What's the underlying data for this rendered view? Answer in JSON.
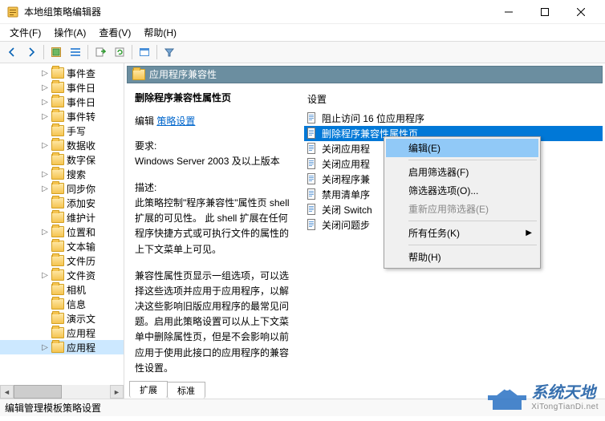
{
  "window": {
    "title": "本地组策略编辑器"
  },
  "menu": {
    "file": "文件(F)",
    "action": "操作(A)",
    "view": "查看(V)",
    "help": "帮助(H)"
  },
  "tree": {
    "items": [
      {
        "label": "事件查",
        "expandable": true
      },
      {
        "label": "事件日",
        "expandable": true
      },
      {
        "label": "事件日",
        "expandable": true
      },
      {
        "label": "事件转",
        "expandable": true
      },
      {
        "label": "手写",
        "expandable": false
      },
      {
        "label": "数据收",
        "expandable": true
      },
      {
        "label": "数字保",
        "expandable": false
      },
      {
        "label": "搜索",
        "expandable": true
      },
      {
        "label": "同步你",
        "expandable": true
      },
      {
        "label": "添加安",
        "expandable": false
      },
      {
        "label": "维护计",
        "expandable": false
      },
      {
        "label": "位置和",
        "expandable": true
      },
      {
        "label": "文本输",
        "expandable": false
      },
      {
        "label": "文件历",
        "expandable": false
      },
      {
        "label": "文件资",
        "expandable": true
      },
      {
        "label": "相机",
        "expandable": false
      },
      {
        "label": "信息",
        "expandable": false
      },
      {
        "label": "演示文",
        "expandable": false
      },
      {
        "label": "应用程",
        "expandable": false
      },
      {
        "label": "应用程",
        "expandable": true,
        "selected": true
      }
    ]
  },
  "content": {
    "header": "应用程序兼容性",
    "desc": {
      "title": "删除程序兼容性属性页",
      "edit_label": "编辑",
      "edit_link": "策略设置",
      "req_label": "要求:",
      "req_text": "Windows Server 2003 及以上版本",
      "info_label": "描述:",
      "info_text1": "此策略控制\"程序兼容性\"属性页 shell 扩展的可见性。  此 shell 扩展在任何程序快捷方式或可执行文件的属性的上下文菜单上可见。",
      "info_text2": "兼容性属性页显示一组选项，可以选择这些选项并应用于应用程序，以解决这些影响旧版应用程序的最常见问题。启用此策略设置可以从上下文菜单中删除属性页，但是不会影响以前应用于使用此接口的应用程序的兼容性设置。"
    },
    "settings_label": "设置",
    "settings": [
      {
        "label": "阻止访问 16 位应用程序"
      },
      {
        "label": "删除程序兼容性属性页",
        "selected": true
      },
      {
        "label": "关闭应用程"
      },
      {
        "label": "关闭应用程"
      },
      {
        "label": "关闭程序兼"
      },
      {
        "label": "禁用清单序"
      },
      {
        "label": "关闭 Switch"
      },
      {
        "label": "关闭问题步"
      }
    ]
  },
  "context_menu": {
    "edit": "编辑(E)",
    "enable_filter": "启用筛选器(F)",
    "filter_options": "筛选器选项(O)...",
    "reapply_filter": "重新应用筛选器(E)",
    "all_tasks": "所有任务(K)",
    "help": "帮助(H)"
  },
  "tabs": {
    "extended": "扩展",
    "standard": "标准"
  },
  "statusbar": {
    "text": "编辑管理模板策略设置"
  },
  "watermark": {
    "main": "系统天地",
    "sub": "XiTongTianDi.net"
  }
}
